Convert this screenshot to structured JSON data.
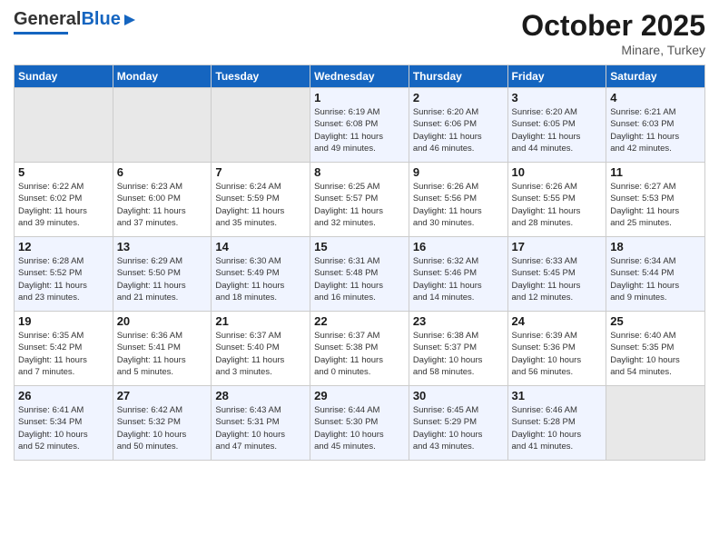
{
  "header": {
    "logo_general": "General",
    "logo_blue": "Blue",
    "month_title": "October 2025",
    "location": "Minare, Turkey"
  },
  "weekdays": [
    "Sunday",
    "Monday",
    "Tuesday",
    "Wednesday",
    "Thursday",
    "Friday",
    "Saturday"
  ],
  "weeks": [
    [
      {
        "day": "",
        "info": ""
      },
      {
        "day": "",
        "info": ""
      },
      {
        "day": "",
        "info": ""
      },
      {
        "day": "1",
        "info": "Sunrise: 6:19 AM\nSunset: 6:08 PM\nDaylight: 11 hours\nand 49 minutes."
      },
      {
        "day": "2",
        "info": "Sunrise: 6:20 AM\nSunset: 6:06 PM\nDaylight: 11 hours\nand 46 minutes."
      },
      {
        "day": "3",
        "info": "Sunrise: 6:20 AM\nSunset: 6:05 PM\nDaylight: 11 hours\nand 44 minutes."
      },
      {
        "day": "4",
        "info": "Sunrise: 6:21 AM\nSunset: 6:03 PM\nDaylight: 11 hours\nand 42 minutes."
      }
    ],
    [
      {
        "day": "5",
        "info": "Sunrise: 6:22 AM\nSunset: 6:02 PM\nDaylight: 11 hours\nand 39 minutes."
      },
      {
        "day": "6",
        "info": "Sunrise: 6:23 AM\nSunset: 6:00 PM\nDaylight: 11 hours\nand 37 minutes."
      },
      {
        "day": "7",
        "info": "Sunrise: 6:24 AM\nSunset: 5:59 PM\nDaylight: 11 hours\nand 35 minutes."
      },
      {
        "day": "8",
        "info": "Sunrise: 6:25 AM\nSunset: 5:57 PM\nDaylight: 11 hours\nand 32 minutes."
      },
      {
        "day": "9",
        "info": "Sunrise: 6:26 AM\nSunset: 5:56 PM\nDaylight: 11 hours\nand 30 minutes."
      },
      {
        "day": "10",
        "info": "Sunrise: 6:26 AM\nSunset: 5:55 PM\nDaylight: 11 hours\nand 28 minutes."
      },
      {
        "day": "11",
        "info": "Sunrise: 6:27 AM\nSunset: 5:53 PM\nDaylight: 11 hours\nand 25 minutes."
      }
    ],
    [
      {
        "day": "12",
        "info": "Sunrise: 6:28 AM\nSunset: 5:52 PM\nDaylight: 11 hours\nand 23 minutes."
      },
      {
        "day": "13",
        "info": "Sunrise: 6:29 AM\nSunset: 5:50 PM\nDaylight: 11 hours\nand 21 minutes."
      },
      {
        "day": "14",
        "info": "Sunrise: 6:30 AM\nSunset: 5:49 PM\nDaylight: 11 hours\nand 18 minutes."
      },
      {
        "day": "15",
        "info": "Sunrise: 6:31 AM\nSunset: 5:48 PM\nDaylight: 11 hours\nand 16 minutes."
      },
      {
        "day": "16",
        "info": "Sunrise: 6:32 AM\nSunset: 5:46 PM\nDaylight: 11 hours\nand 14 minutes."
      },
      {
        "day": "17",
        "info": "Sunrise: 6:33 AM\nSunset: 5:45 PM\nDaylight: 11 hours\nand 12 minutes."
      },
      {
        "day": "18",
        "info": "Sunrise: 6:34 AM\nSunset: 5:44 PM\nDaylight: 11 hours\nand 9 minutes."
      }
    ],
    [
      {
        "day": "19",
        "info": "Sunrise: 6:35 AM\nSunset: 5:42 PM\nDaylight: 11 hours\nand 7 minutes."
      },
      {
        "day": "20",
        "info": "Sunrise: 6:36 AM\nSunset: 5:41 PM\nDaylight: 11 hours\nand 5 minutes."
      },
      {
        "day": "21",
        "info": "Sunrise: 6:37 AM\nSunset: 5:40 PM\nDaylight: 11 hours\nand 3 minutes."
      },
      {
        "day": "22",
        "info": "Sunrise: 6:37 AM\nSunset: 5:38 PM\nDaylight: 11 hours\nand 0 minutes."
      },
      {
        "day": "23",
        "info": "Sunrise: 6:38 AM\nSunset: 5:37 PM\nDaylight: 10 hours\nand 58 minutes."
      },
      {
        "day": "24",
        "info": "Sunrise: 6:39 AM\nSunset: 5:36 PM\nDaylight: 10 hours\nand 56 minutes."
      },
      {
        "day": "25",
        "info": "Sunrise: 6:40 AM\nSunset: 5:35 PM\nDaylight: 10 hours\nand 54 minutes."
      }
    ],
    [
      {
        "day": "26",
        "info": "Sunrise: 6:41 AM\nSunset: 5:34 PM\nDaylight: 10 hours\nand 52 minutes."
      },
      {
        "day": "27",
        "info": "Sunrise: 6:42 AM\nSunset: 5:32 PM\nDaylight: 10 hours\nand 50 minutes."
      },
      {
        "day": "28",
        "info": "Sunrise: 6:43 AM\nSunset: 5:31 PM\nDaylight: 10 hours\nand 47 minutes."
      },
      {
        "day": "29",
        "info": "Sunrise: 6:44 AM\nSunset: 5:30 PM\nDaylight: 10 hours\nand 45 minutes."
      },
      {
        "day": "30",
        "info": "Sunrise: 6:45 AM\nSunset: 5:29 PM\nDaylight: 10 hours\nand 43 minutes."
      },
      {
        "day": "31",
        "info": "Sunrise: 6:46 AM\nSunset: 5:28 PM\nDaylight: 10 hours\nand 41 minutes."
      },
      {
        "day": "",
        "info": ""
      }
    ]
  ]
}
